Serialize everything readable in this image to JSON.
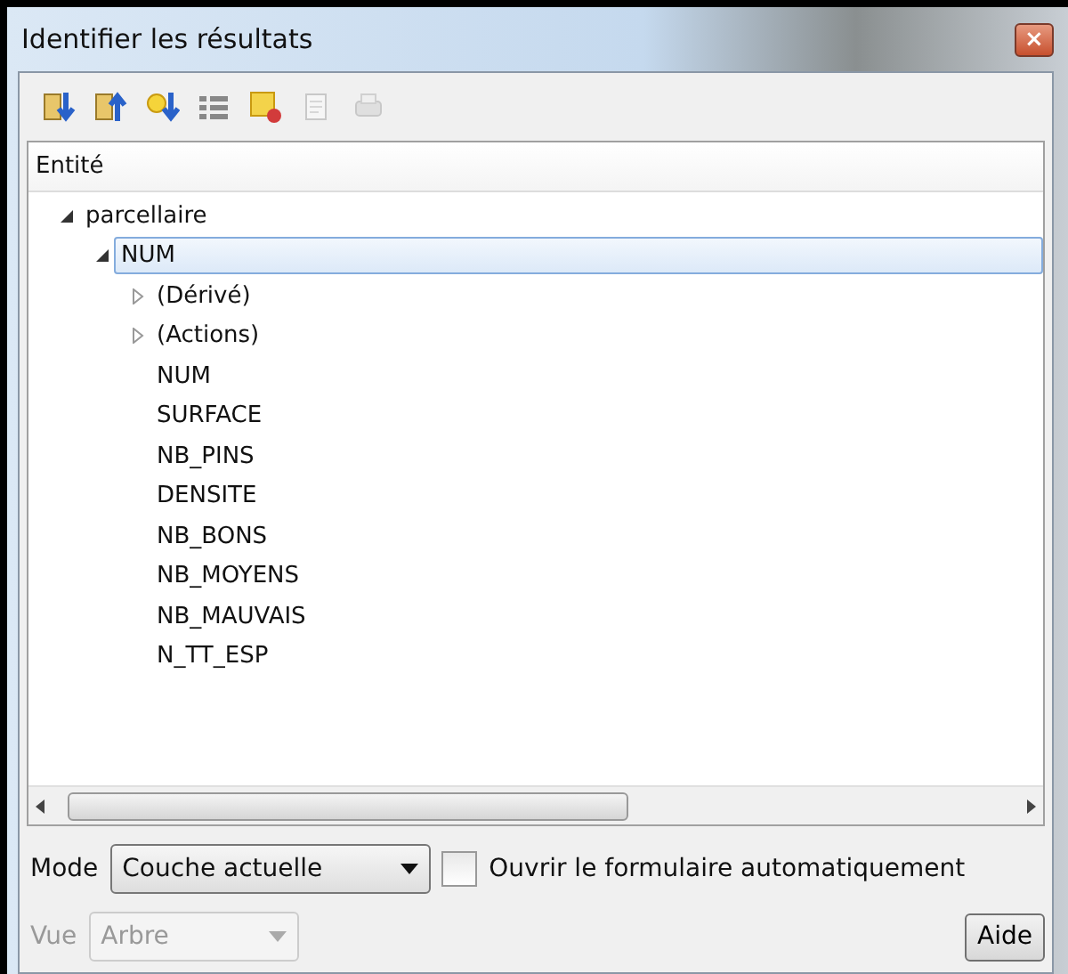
{
  "window": {
    "title": "Identifier les résultats",
    "close": "×"
  },
  "toolbar": [
    {
      "kind": "expand",
      "disabled": false
    },
    {
      "kind": "collapse",
      "disabled": false
    },
    {
      "kind": "expand-new",
      "disabled": false
    },
    {
      "kind": "list",
      "disabled": false
    },
    {
      "kind": "clear",
      "disabled": false
    },
    {
      "kind": "copy",
      "disabled": true
    },
    {
      "kind": "print",
      "disabled": true
    }
  ],
  "tree": {
    "column": "Entité",
    "items": [
      {
        "label": "parcellaire",
        "expanded": true,
        "selected": false,
        "children": [
          {
            "label": "NUM",
            "expanded": true,
            "selected": true,
            "children": [
              {
                "label": "(Dérivé)",
                "expanded": false,
                "selected": false
              },
              {
                "label": "(Actions)",
                "expanded": false,
                "selected": false
              },
              {
                "label": "NUM",
                "selected": false
              },
              {
                "label": "SURFACE",
                "selected": false
              },
              {
                "label": "NB_PINS",
                "selected": false
              },
              {
                "label": "DENSITE",
                "selected": false
              },
              {
                "label": "NB_BONS",
                "selected": false
              },
              {
                "label": "NB_MOYENS",
                "selected": false
              },
              {
                "label": "NB_MAUVAIS",
                "selected": false
              },
              {
                "label": "N_TT_ESP",
                "selected": false
              }
            ]
          }
        ]
      }
    ]
  },
  "mode": {
    "label": "Mode",
    "value": "Couche actuelle",
    "disabled": false
  },
  "auto_open": {
    "label": "Ouvrir le formulaire automatiquement",
    "checked": false
  },
  "view": {
    "label": "Vue",
    "value": "Arbre",
    "disabled": true
  },
  "help_button": "Aide"
}
